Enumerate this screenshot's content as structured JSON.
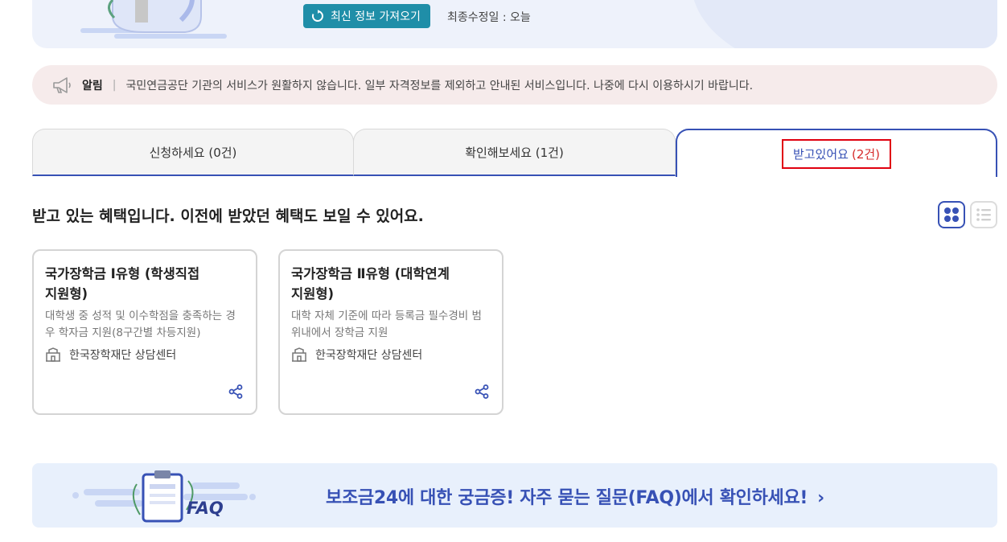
{
  "hero": {
    "refresh_label": "최신 정보 가져오기",
    "updated_text": "최종수정일 : 오늘"
  },
  "notice": {
    "label": "알림",
    "separator": "|",
    "message": "국민연금공단 기관의 서비스가 원활하지 않습니다. 일부 자격정보를 제외하고 안내된 서비스입니다. 나중에 다시 이용하시기 바랍니다."
  },
  "tabs": [
    {
      "label": "신청하세요 (0건)"
    },
    {
      "label": "확인해보세요 (1건)"
    },
    {
      "label": "받고있어요",
      "count": "(2건)",
      "active": true
    }
  ],
  "section": {
    "title": "받고 있는 혜택입니다. 이전에 받았던 혜택도 보일 수 있어요."
  },
  "cards": [
    {
      "title": "국가장학금 Ⅰ유형 (학생직접지원형)",
      "desc": "대학생 중 성적 및 이수학점을 충족하는 경우 학자금 지원(8구간별 차등지원)",
      "org": "한국장학재단 상담센터"
    },
    {
      "title": "국가장학금 Ⅱ유형 (대학연계지원형)",
      "desc": "대학 자체 기준에 따라 등록금 필수경비 범위내에서 장학금 지원",
      "org": "한국장학재단 상담센터"
    }
  ],
  "faq": {
    "badge": "FAQ",
    "text": "보조금24에 대한 궁금증! 자주 묻는 질문(FAQ)에서 확인하세요!",
    "chevron": "›"
  },
  "colors": {
    "accent": "#3751b5",
    "refresh_bg": "#1f8ea8",
    "notice_bg": "#f6ebeb",
    "count_red": "#d62b2b",
    "highlight_box": "#e0000f"
  }
}
